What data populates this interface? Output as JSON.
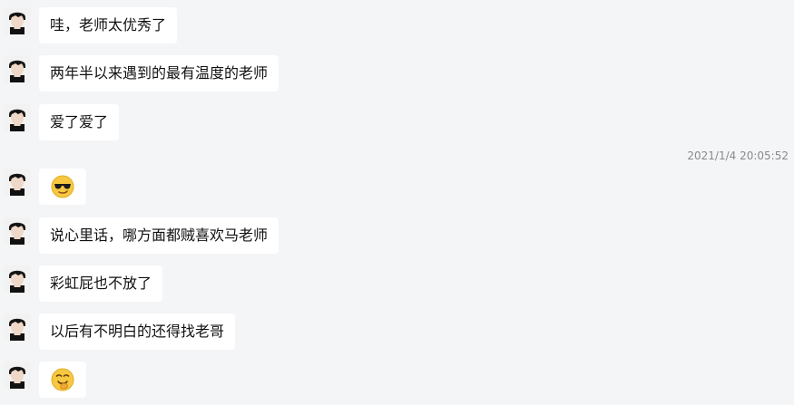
{
  "timestamp": "2021/1/4 20:05:52",
  "messages": [
    {
      "text": "哇，老师太优秀了"
    },
    {
      "text": "两年半以来遇到的最有温度的老师"
    },
    {
      "text": "爱了爱了"
    },
    {
      "emoji": "cool-sunglasses-emoji"
    },
    {
      "text": "说心里话，哪方面都贼喜欢马老师"
    },
    {
      "text": "彩虹屁也不放了"
    },
    {
      "text": "以后有不明白的还得找老哥"
    },
    {
      "emoji": "chuckle-emoji"
    }
  ]
}
